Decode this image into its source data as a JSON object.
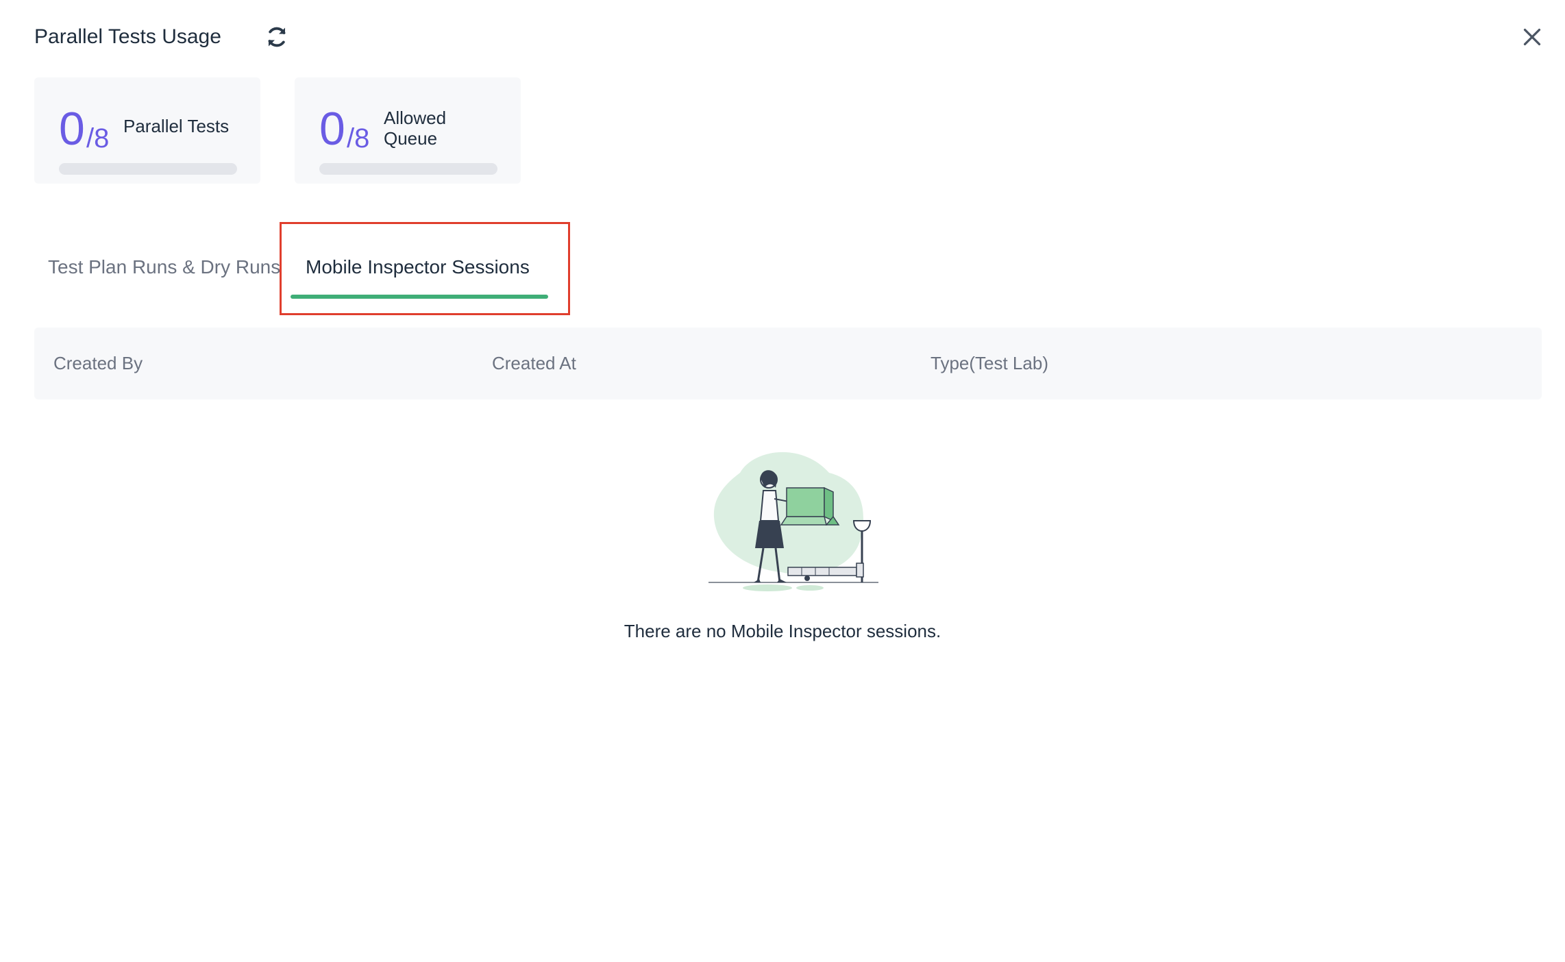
{
  "header": {
    "title": "Parallel Tests Usage"
  },
  "cards": [
    {
      "used": "0",
      "total": "/8",
      "label": "Parallel Tests",
      "progress_percent": 0
    },
    {
      "used": "0",
      "total": "/8",
      "label_line1": "Allowed",
      "label_line2": "Queue",
      "progress_percent": 0
    }
  ],
  "tabs": [
    {
      "label": "Test Plan Runs & Dry Runs",
      "active": false
    },
    {
      "label": "Mobile Inspector Sessions",
      "active": true
    }
  ],
  "table": {
    "columns": [
      "Created By",
      "Created At",
      "Type(Test Lab)"
    ]
  },
  "empty_state": {
    "message": "There are no Mobile Inspector sessions."
  },
  "colors": {
    "accent": "#6a5ce4",
    "active_tab_underline": "#3fae77",
    "highlight_box": "#e03e2d"
  }
}
